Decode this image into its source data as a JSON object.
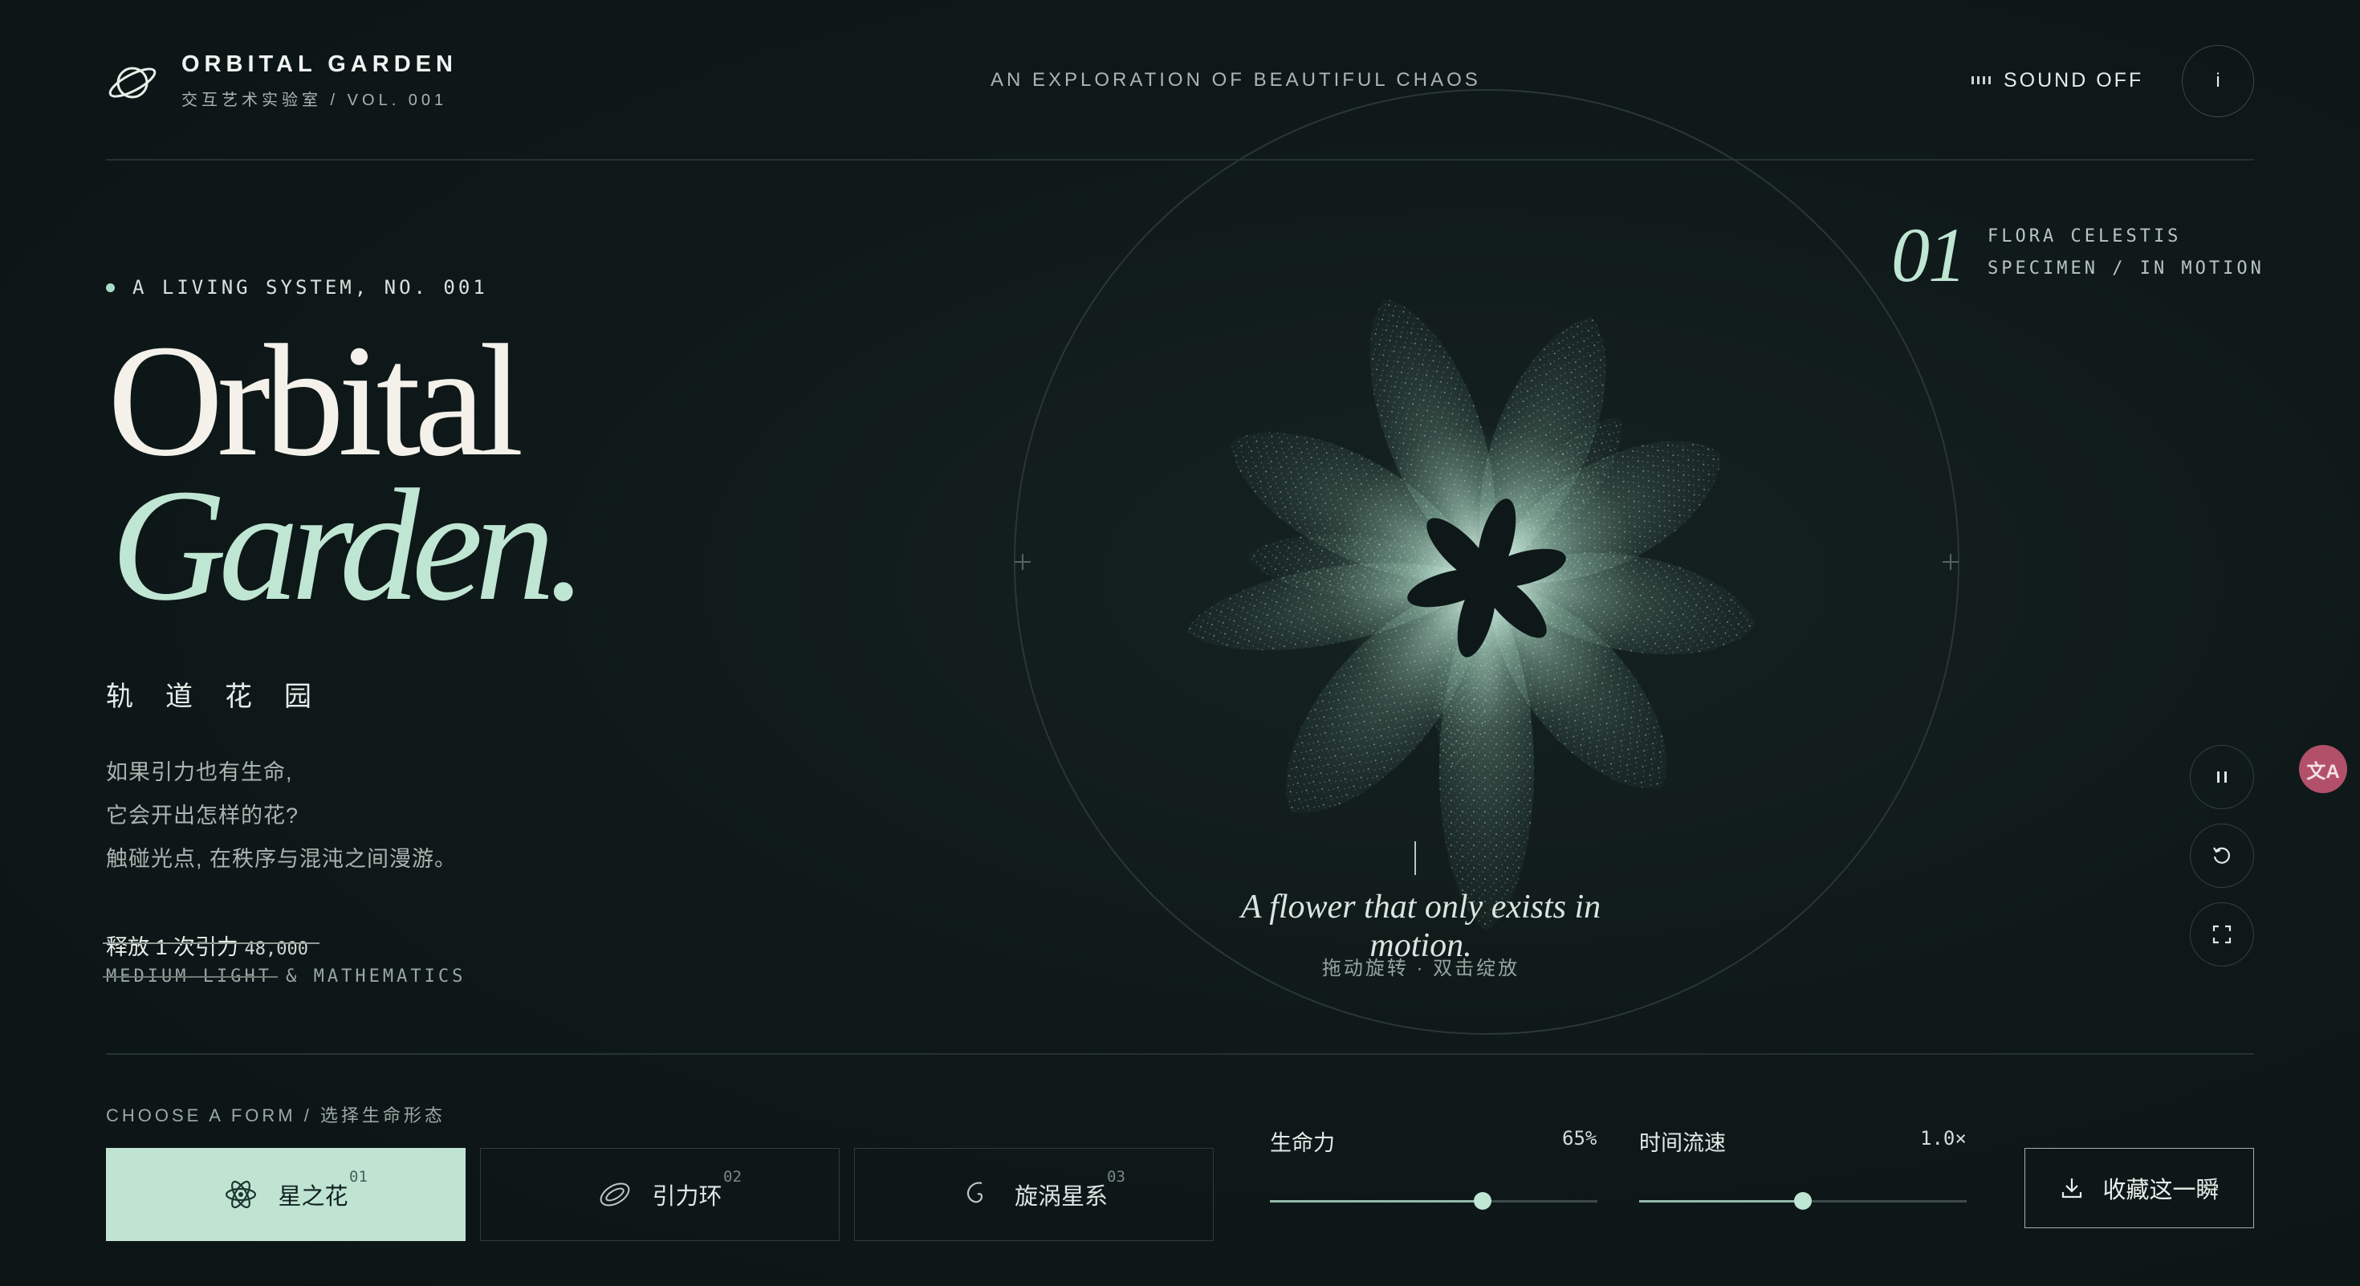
{
  "header": {
    "brand_title": "ORBITAL GARDEN",
    "brand_subtitle": "交互艺术实验室 / VOL. 001",
    "tagline": "AN EXPLORATION OF BEAUTIFUL CHAOS",
    "sound_label": "SOUND OFF",
    "info_label": "i"
  },
  "hero": {
    "eyebrow": "A LIVING SYSTEM, NO. 001",
    "title_line1": "Orbital",
    "title_line2": "Garden.",
    "cn_title": "轨道花园",
    "description": [
      "如果引力也有生命,",
      "它会开出怎样的花?",
      "触碰光点, 在秩序与混沌之间漫游。"
    ],
    "stat_text": "释放 1 次引力",
    "stat_value": "48,000",
    "medium": "MEDIUM LIGHT & MATHEMATICS"
  },
  "stage": {
    "caption": "A flower that only exists in motion.",
    "hint": "拖动旋转 · 双击绽放"
  },
  "specimen": {
    "number": "01",
    "line1": "FLORA CELESTIS",
    "line2": "SPECIMEN / IN MOTION"
  },
  "controls": {
    "pause": "pause-icon",
    "reset": "reset-icon",
    "fullscreen": "fullscreen-icon"
  },
  "forms": {
    "label": "CHOOSE A FORM / 选择生命形态",
    "items": [
      {
        "name": "星之花",
        "index": "01",
        "icon": "atom-icon",
        "active": true
      },
      {
        "name": "引力环",
        "index": "02",
        "icon": "ring-icon",
        "active": false
      },
      {
        "name": "旋涡星系",
        "index": "03",
        "icon": "spiral-icon",
        "active": false
      }
    ]
  },
  "sliders": {
    "vitality": {
      "label": "生命力",
      "value_text": "65%",
      "value": 0.65
    },
    "time_flow": {
      "label": "时间流速",
      "value_text": "1.0×",
      "value": 0.5
    }
  },
  "save_label": "收藏这一瞬",
  "colors": {
    "accent": "#bfe6d3",
    "background": "#0f1919",
    "badge": "#b2506a"
  }
}
